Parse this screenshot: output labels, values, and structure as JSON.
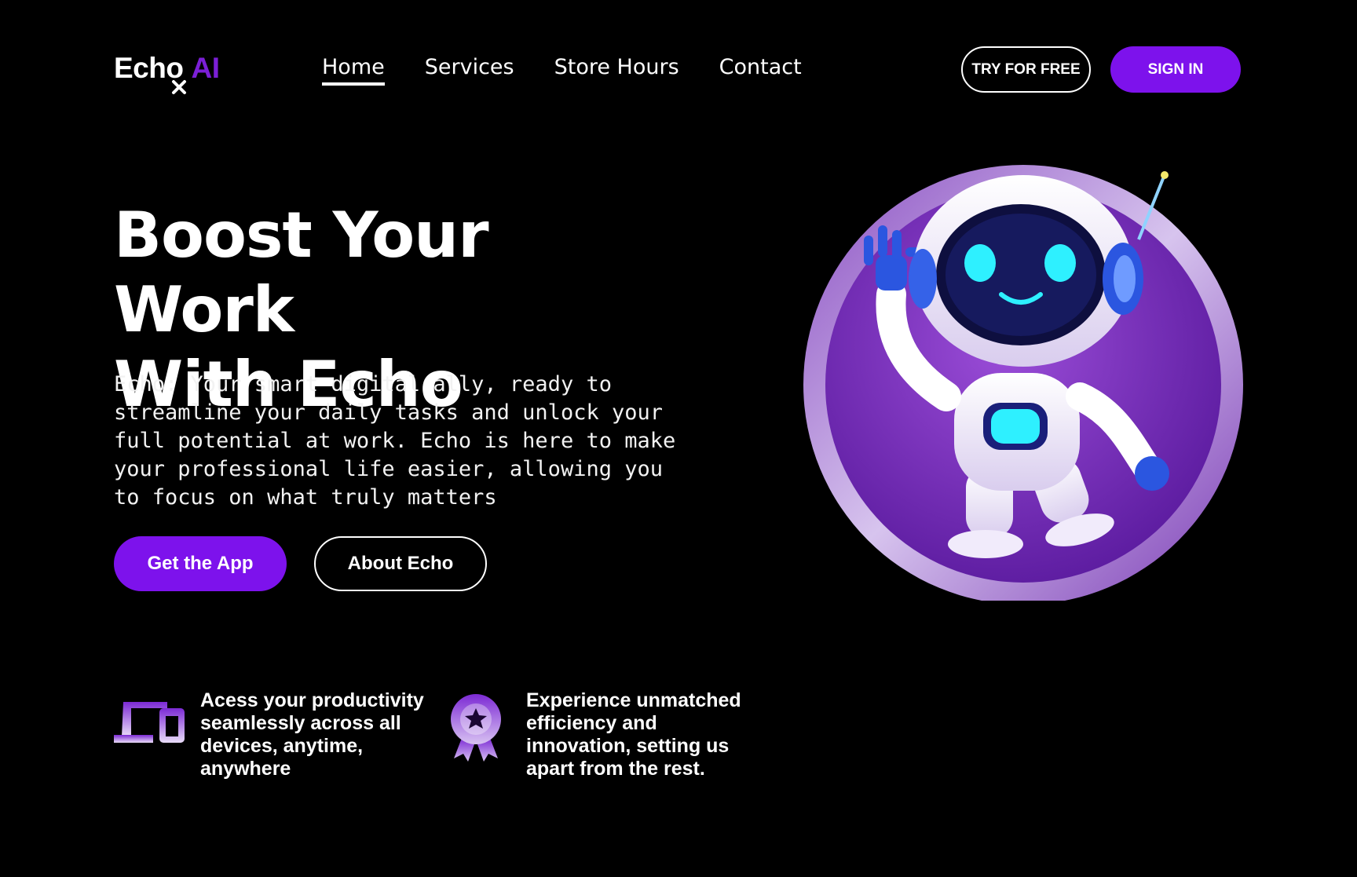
{
  "brand": {
    "name": "Echo",
    "suffix": "AI",
    "accent_color": "#7d12ec"
  },
  "nav": {
    "items": [
      {
        "label": "Home",
        "active": true
      },
      {
        "label": "Services",
        "active": false
      },
      {
        "label": "Store Hours",
        "active": false
      },
      {
        "label": "Contact",
        "active": false
      }
    ]
  },
  "header": {
    "try_label": "TRY FOR FREE",
    "signin_label": "SIGN IN"
  },
  "hero": {
    "title_line1": "Boost Your Work",
    "title_line2": "With Echo",
    "description": "Echo: Your smart digital ally, ready to streamline your daily tasks and unlock your full potential at work. Echo is here to make your professional life easier, allowing you to focus on what truly matters",
    "primary_cta": "Get the App",
    "secondary_cta": "About Echo",
    "illustration": "robot-illustration"
  },
  "features": [
    {
      "icon": "devices-icon",
      "text": "Acess your productivity seamlessly across all devices, anytime, anywhere"
    },
    {
      "icon": "badge-star-icon",
      "text": "Experience unmatched efficiency and innovation, setting us apart from the rest."
    }
  ]
}
